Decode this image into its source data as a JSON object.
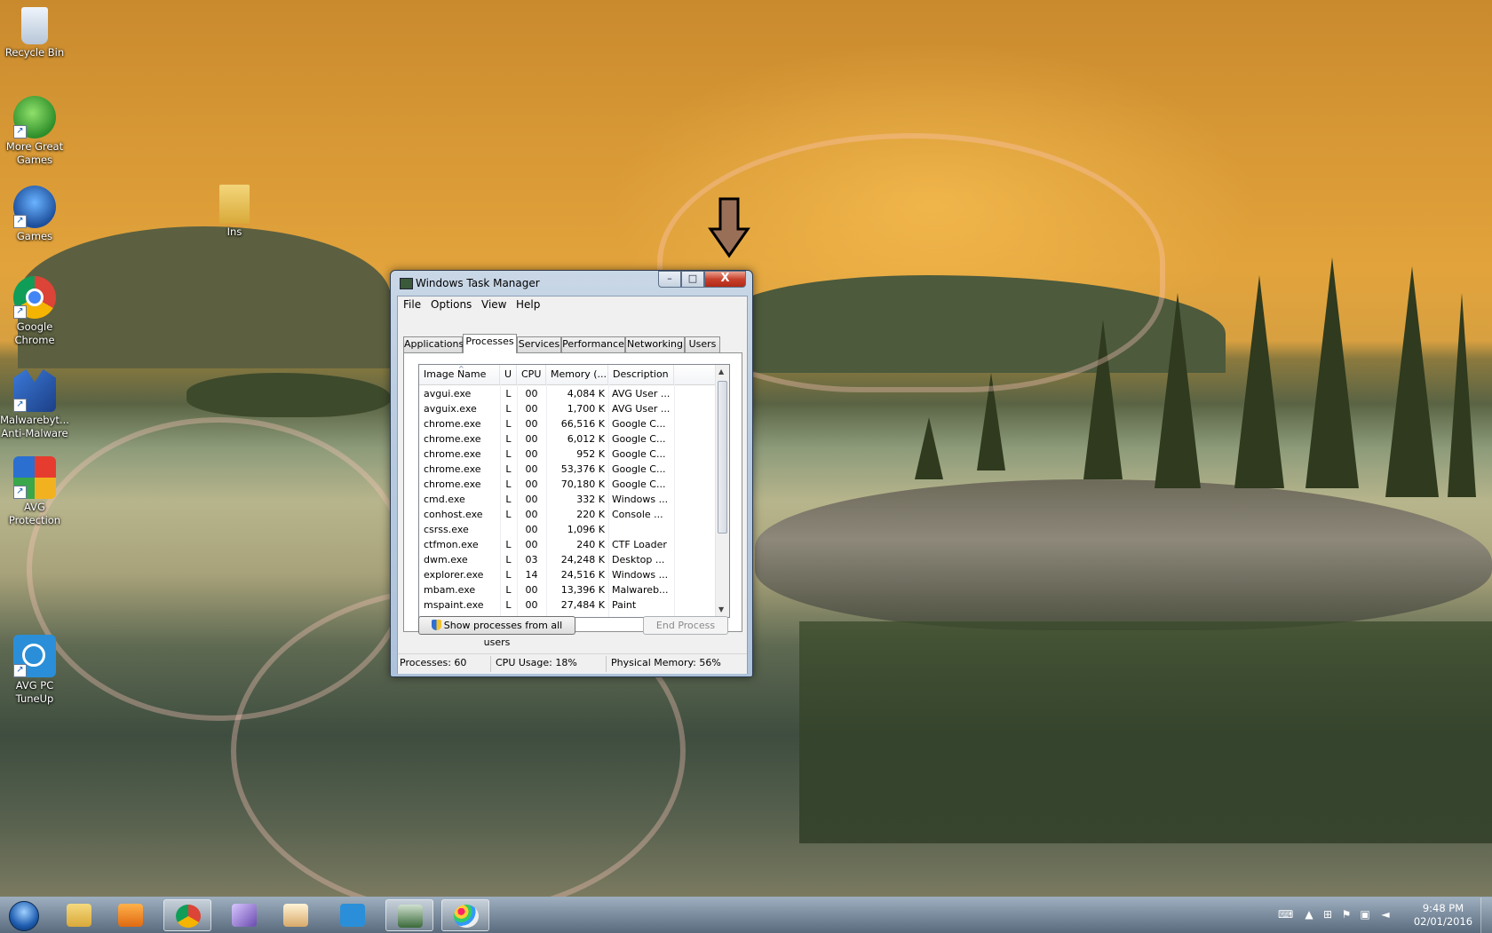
{
  "desktop": {
    "icons": [
      {
        "label": "Recycle Bin",
        "icon": "recycle-bin-icon"
      },
      {
        "label": "More Great Games",
        "icon": "more-games-icon"
      },
      {
        "label": "Games",
        "icon": "big-fish-games-icon"
      },
      {
        "label": "Google Chrome",
        "icon": "chrome-icon"
      },
      {
        "label": "Malwarebyt... Anti-Malware",
        "icon": "malwarebytes-icon"
      },
      {
        "label": "AVG Protection",
        "icon": "avg-icon"
      },
      {
        "label": "AVG PC TuneUp",
        "icon": "avg-tuneup-icon"
      },
      {
        "label": "Ins",
        "icon": "folder-icon"
      }
    ]
  },
  "window": {
    "title": "Windows Task Manager",
    "buttons": {
      "minimize": "–",
      "maximize": "□",
      "close": "X"
    },
    "menu": [
      "File",
      "Options",
      "View",
      "Help"
    ],
    "tabs": [
      "Applications",
      "Processes",
      "Services",
      "Performance",
      "Networking",
      "Users"
    ],
    "active_tab": "Processes",
    "columns": [
      "Image Name",
      "U",
      "CPU",
      "Memory (...",
      "Description"
    ],
    "processes": [
      {
        "name": "avgui.exe",
        "user": "L",
        "cpu": "00",
        "memory": "4,084 K",
        "description": "AVG User ..."
      },
      {
        "name": "avguix.exe",
        "user": "L",
        "cpu": "00",
        "memory": "1,700 K",
        "description": "AVG User ..."
      },
      {
        "name": "chrome.exe",
        "user": "L",
        "cpu": "00",
        "memory": "66,516 K",
        "description": "Google C..."
      },
      {
        "name": "chrome.exe",
        "user": "L",
        "cpu": "00",
        "memory": "6,012 K",
        "description": "Google C..."
      },
      {
        "name": "chrome.exe",
        "user": "L",
        "cpu": "00",
        "memory": "952 K",
        "description": "Google C..."
      },
      {
        "name": "chrome.exe",
        "user": "L",
        "cpu": "00",
        "memory": "53,376 K",
        "description": "Google C..."
      },
      {
        "name": "chrome.exe",
        "user": "L",
        "cpu": "00",
        "memory": "70,180 K",
        "description": "Google C..."
      },
      {
        "name": "cmd.exe",
        "user": "L",
        "cpu": "00",
        "memory": "332 K",
        "description": "Windows ..."
      },
      {
        "name": "conhost.exe",
        "user": "L",
        "cpu": "00",
        "memory": "220 K",
        "description": "Console ..."
      },
      {
        "name": "csrss.exe",
        "user": "",
        "cpu": "00",
        "memory": "1,096 K",
        "description": ""
      },
      {
        "name": "ctfmon.exe",
        "user": "L",
        "cpu": "00",
        "memory": "240 K",
        "description": "CTF Loader"
      },
      {
        "name": "dwm.exe",
        "user": "L",
        "cpu": "03",
        "memory": "24,248 K",
        "description": "Desktop ..."
      },
      {
        "name": "explorer.exe",
        "user": "L",
        "cpu": "14",
        "memory": "24,516 K",
        "description": "Windows ..."
      },
      {
        "name": "mbam.exe",
        "user": "L",
        "cpu": "00",
        "memory": "13,396 K",
        "description": "Malwareb..."
      },
      {
        "name": "mspaint.exe",
        "user": "L",
        "cpu": "00",
        "memory": "27,484 K",
        "description": "Paint"
      }
    ],
    "show_all_users_button": "Show processes from all users",
    "end_process_button": "End Process",
    "status": {
      "processes": "Processes: 60",
      "cpu": "CPU Usage: 18%",
      "memory": "Physical Memory: 56%"
    }
  },
  "taskbar": {
    "items": [
      {
        "icon": "windows-explorer-icon",
        "active": false
      },
      {
        "icon": "media-player-icon",
        "active": false
      },
      {
        "icon": "chrome-icon",
        "active": true
      },
      {
        "icon": "card-game-icon",
        "active": false
      },
      {
        "icon": "mahjong-game-icon",
        "active": false
      },
      {
        "icon": "avg-tuneup-icon",
        "active": false
      },
      {
        "icon": "task-manager-icon",
        "active": true
      },
      {
        "icon": "paint-icon",
        "active": true
      }
    ],
    "clock_time": "9:48 PM",
    "clock_date": "02/01/2016"
  },
  "colors": {
    "close_button": "#c8412c",
    "title_bar": "#b8cbe0",
    "annotation_arrow": "#9a6f58"
  }
}
